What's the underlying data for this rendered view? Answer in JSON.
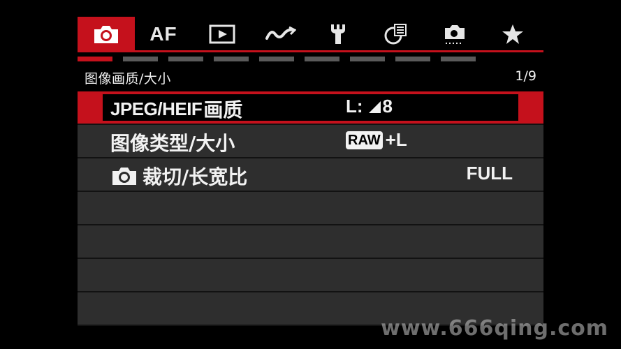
{
  "tabs": [
    {
      "id": "shooting",
      "icon": "camera-icon",
      "label": ""
    },
    {
      "id": "af",
      "icon": "",
      "label": "AF"
    },
    {
      "id": "playback",
      "icon": "playback-icon",
      "label": ""
    },
    {
      "id": "wireless",
      "icon": "wireless-icon",
      "label": ""
    },
    {
      "id": "setup",
      "icon": "wrench-icon",
      "label": ""
    },
    {
      "id": "custom",
      "icon": "custom-functions-icon",
      "label": ""
    },
    {
      "id": "my-menu-settings",
      "icon": "camera-settings-icon",
      "label": ""
    },
    {
      "id": "my-menu",
      "icon": "star-icon",
      "label": ""
    }
  ],
  "active_tab": 0,
  "pager": {
    "count": 9,
    "current": 0
  },
  "header": {
    "title": "图像画质/大小",
    "page": "1/9"
  },
  "rows": [
    {
      "label_latin": "JPEG/HEIF",
      "label_cjk": "画质",
      "value_prefix": "L:",
      "value_suffix": "8",
      "value_icon": "fine-quality-icon",
      "selected": true
    },
    {
      "label_latin": "",
      "label_cjk": "图像类型/大小",
      "value_badge": "RAW",
      "value_text": "+L",
      "selected": false
    },
    {
      "label_latin": "",
      "label_cjk": "裁切/长宽比",
      "label_icon": "camera-icon",
      "value_text": "FULL",
      "selected": false
    }
  ],
  "empty_rows": 4,
  "watermark": "www.666qing.com",
  "colors": {
    "accent": "#c5111c",
    "row_bg": "#2e2e2e",
    "text": "#f2f2f2"
  }
}
